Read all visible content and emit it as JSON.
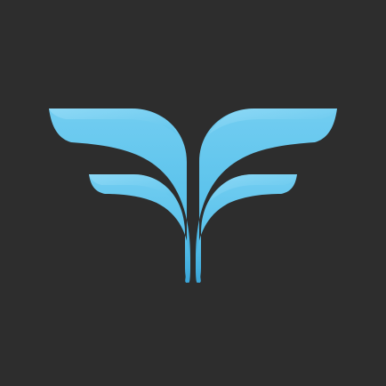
{
  "icon": "winged-f-logo-icon",
  "colors": {
    "background": "#2d2d2d",
    "wing_light": "#72cdf1",
    "wing_mid": "#5ac2eb",
    "wing_dark": "#3aa6d9",
    "fold_highlight": "#a6e3fa"
  }
}
